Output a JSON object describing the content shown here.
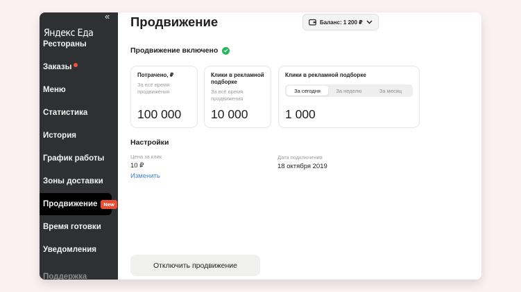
{
  "sidebar": {
    "logo": "Яндекс Еда",
    "collapse": "«",
    "items": [
      {
        "label": "Рестораны"
      },
      {
        "label": "Заказы"
      },
      {
        "label": "Меню"
      },
      {
        "label": "Статистика"
      },
      {
        "label": "История"
      },
      {
        "label": "График работы"
      },
      {
        "label": "Зоны доставки"
      },
      {
        "label": "Продвижение",
        "badge": "New"
      },
      {
        "label": "Время готовки"
      },
      {
        "label": "Уведомления"
      }
    ],
    "cut_item": "Поддержка"
  },
  "header": {
    "title": "Продвижение",
    "balance": "Баланс: 1 200 ₽"
  },
  "status": {
    "text": "Продвижение включено"
  },
  "cards": [
    {
      "title": "Потрачено, ₽",
      "subtitle": "За всё время продвижения",
      "value": "100 000"
    },
    {
      "title": "Клики в рекламной подборке",
      "subtitle": "За всё время продвижения",
      "value": "10 000"
    },
    {
      "title": "Клики в рекламной подборке",
      "tabs": [
        "За сегодня",
        "За неделю",
        "За месяц"
      ],
      "active_tab": "За сегодня",
      "value": "1 000"
    }
  ],
  "settings": {
    "title": "Настройки",
    "price_label": "Цена за клик",
    "price_value": "10 ₽",
    "change_link": "Изменить",
    "date_label": "Дата подключения",
    "date_value": "18 октября 2019"
  },
  "actions": {
    "disable": "Отключить продвижение"
  },
  "colors": {
    "sidebar_bg": "#2f3033",
    "active_bg": "#000000",
    "badge": "#e84e36",
    "success": "#28b35e",
    "link": "#3a85d7"
  }
}
